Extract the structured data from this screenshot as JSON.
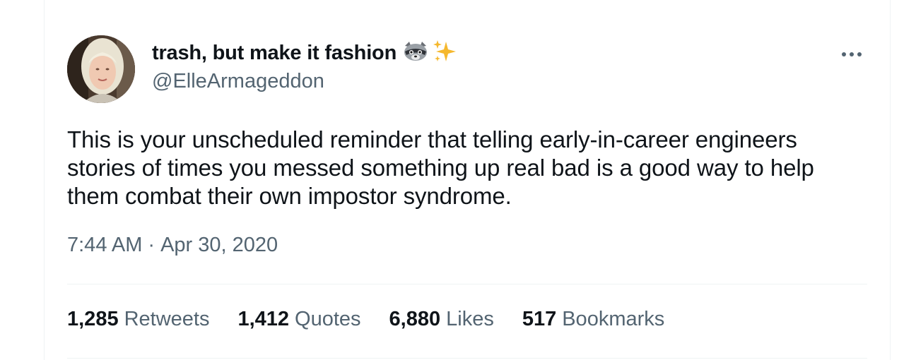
{
  "author": {
    "display_name": "trash, but make it fashion",
    "handle": "@ElleArmageddon",
    "name_emojis": [
      "raccoon-icon",
      "sparkles-icon"
    ]
  },
  "tweet": {
    "text": "This is your unscheduled reminder that telling early-in-career engineers stories of times you messed something up real bad is a good way to help them combat their own impostor syndrome.",
    "time": "7:44 AM",
    "separator": "·",
    "date": "Apr 30, 2020"
  },
  "stats": [
    {
      "count": "1,285",
      "label": "Retweets"
    },
    {
      "count": "1,412",
      "label": "Quotes"
    },
    {
      "count": "6,880",
      "label": "Likes"
    },
    {
      "count": "517",
      "label": "Bookmarks"
    }
  ],
  "colors": {
    "text_primary": "#0f1419",
    "text_secondary": "#536471",
    "divider": "#eff3f4",
    "sparkle": "#f5b82e"
  }
}
